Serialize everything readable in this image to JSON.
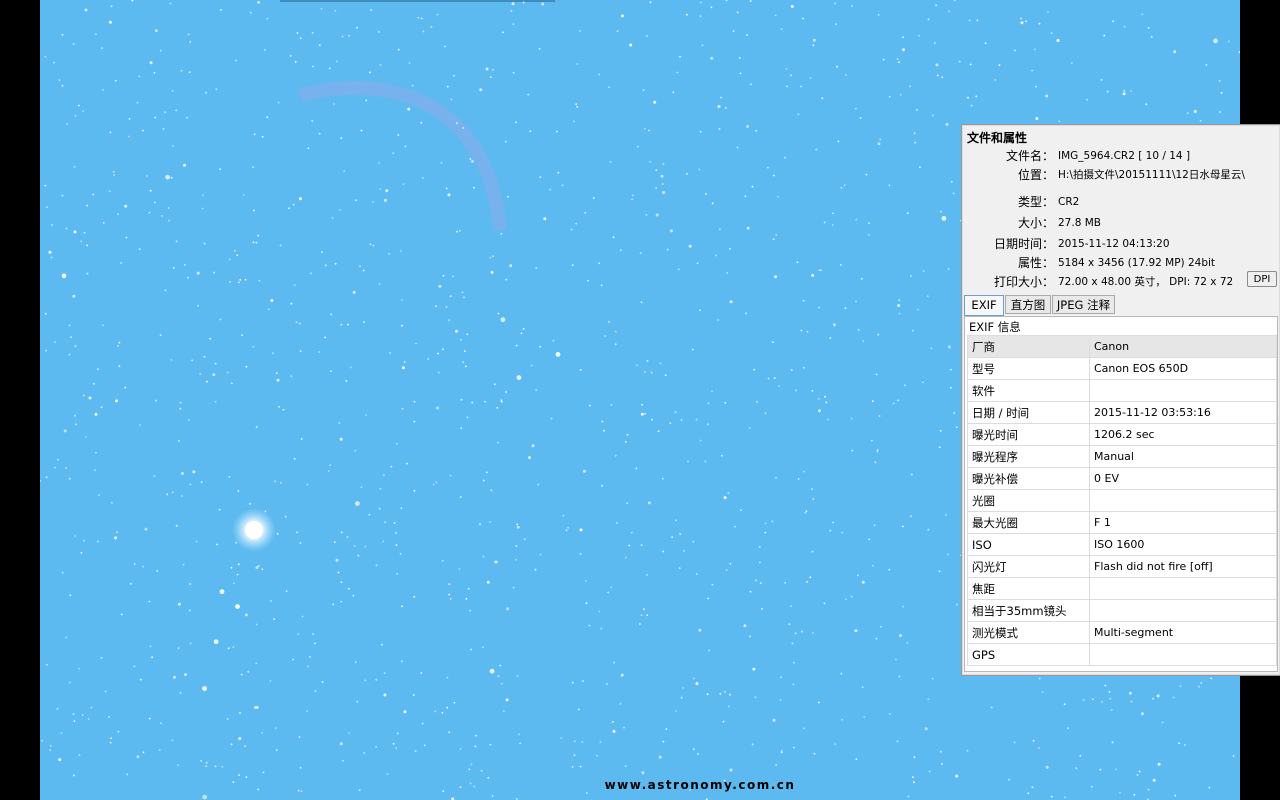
{
  "watermark": "www.astronomy.com.cn",
  "properties": {
    "title": "文件和属性",
    "rows": [
      {
        "label": "文件名：",
        "value": "IMG_5964.CR2   [ 10 / 14 ]"
      },
      {
        "label": "位置：",
        "value": "H:\\拍摄文件\\20151111\\12日水母星云\\"
      },
      {
        "label": "类型：",
        "value": "CR2"
      },
      {
        "label": "大小：",
        "value": "27.8 MB"
      },
      {
        "label": "日期时间：",
        "value": "2015-11-12 04:13:20"
      },
      {
        "label": "属性：",
        "value": "5184 x 3456 (17.92 MP)  24bit"
      },
      {
        "label": "打印大小：",
        "value": "72.00 x 48.00 英寸，  DPI: 72 x 72"
      }
    ],
    "dpi_button": "DPI"
  },
  "tabs": [
    {
      "label": "EXIF",
      "active": true
    },
    {
      "label": "直方图",
      "active": false
    },
    {
      "label": "JPEG 注释",
      "active": false
    }
  ],
  "exif": {
    "title": "EXIF 信息",
    "rows": [
      {
        "key": "厂商",
        "value": "Canon"
      },
      {
        "key": "型号",
        "value": "Canon EOS 650D"
      },
      {
        "key": "软件",
        "value": ""
      },
      {
        "key": "日期 / 时间",
        "value": "2015-11-12 03:53:16"
      },
      {
        "key": "曝光时间",
        "value": "1206.2 sec"
      },
      {
        "key": "曝光程序",
        "value": "Manual"
      },
      {
        "key": "曝光补偿",
        "value": "0 EV"
      },
      {
        "key": "光圈",
        "value": ""
      },
      {
        "key": "最大光圈",
        "value": "F 1"
      },
      {
        "key": "ISO",
        "value": "ISO 1600"
      },
      {
        "key": "闪光灯",
        "value": "Flash did not fire [off]"
      },
      {
        "key": "焦距",
        "value": ""
      },
      {
        "key": "相当于35mm镜头",
        "value": ""
      },
      {
        "key": "测光模式",
        "value": "Multi-segment"
      },
      {
        "key": "GPS",
        "value": ""
      }
    ]
  }
}
